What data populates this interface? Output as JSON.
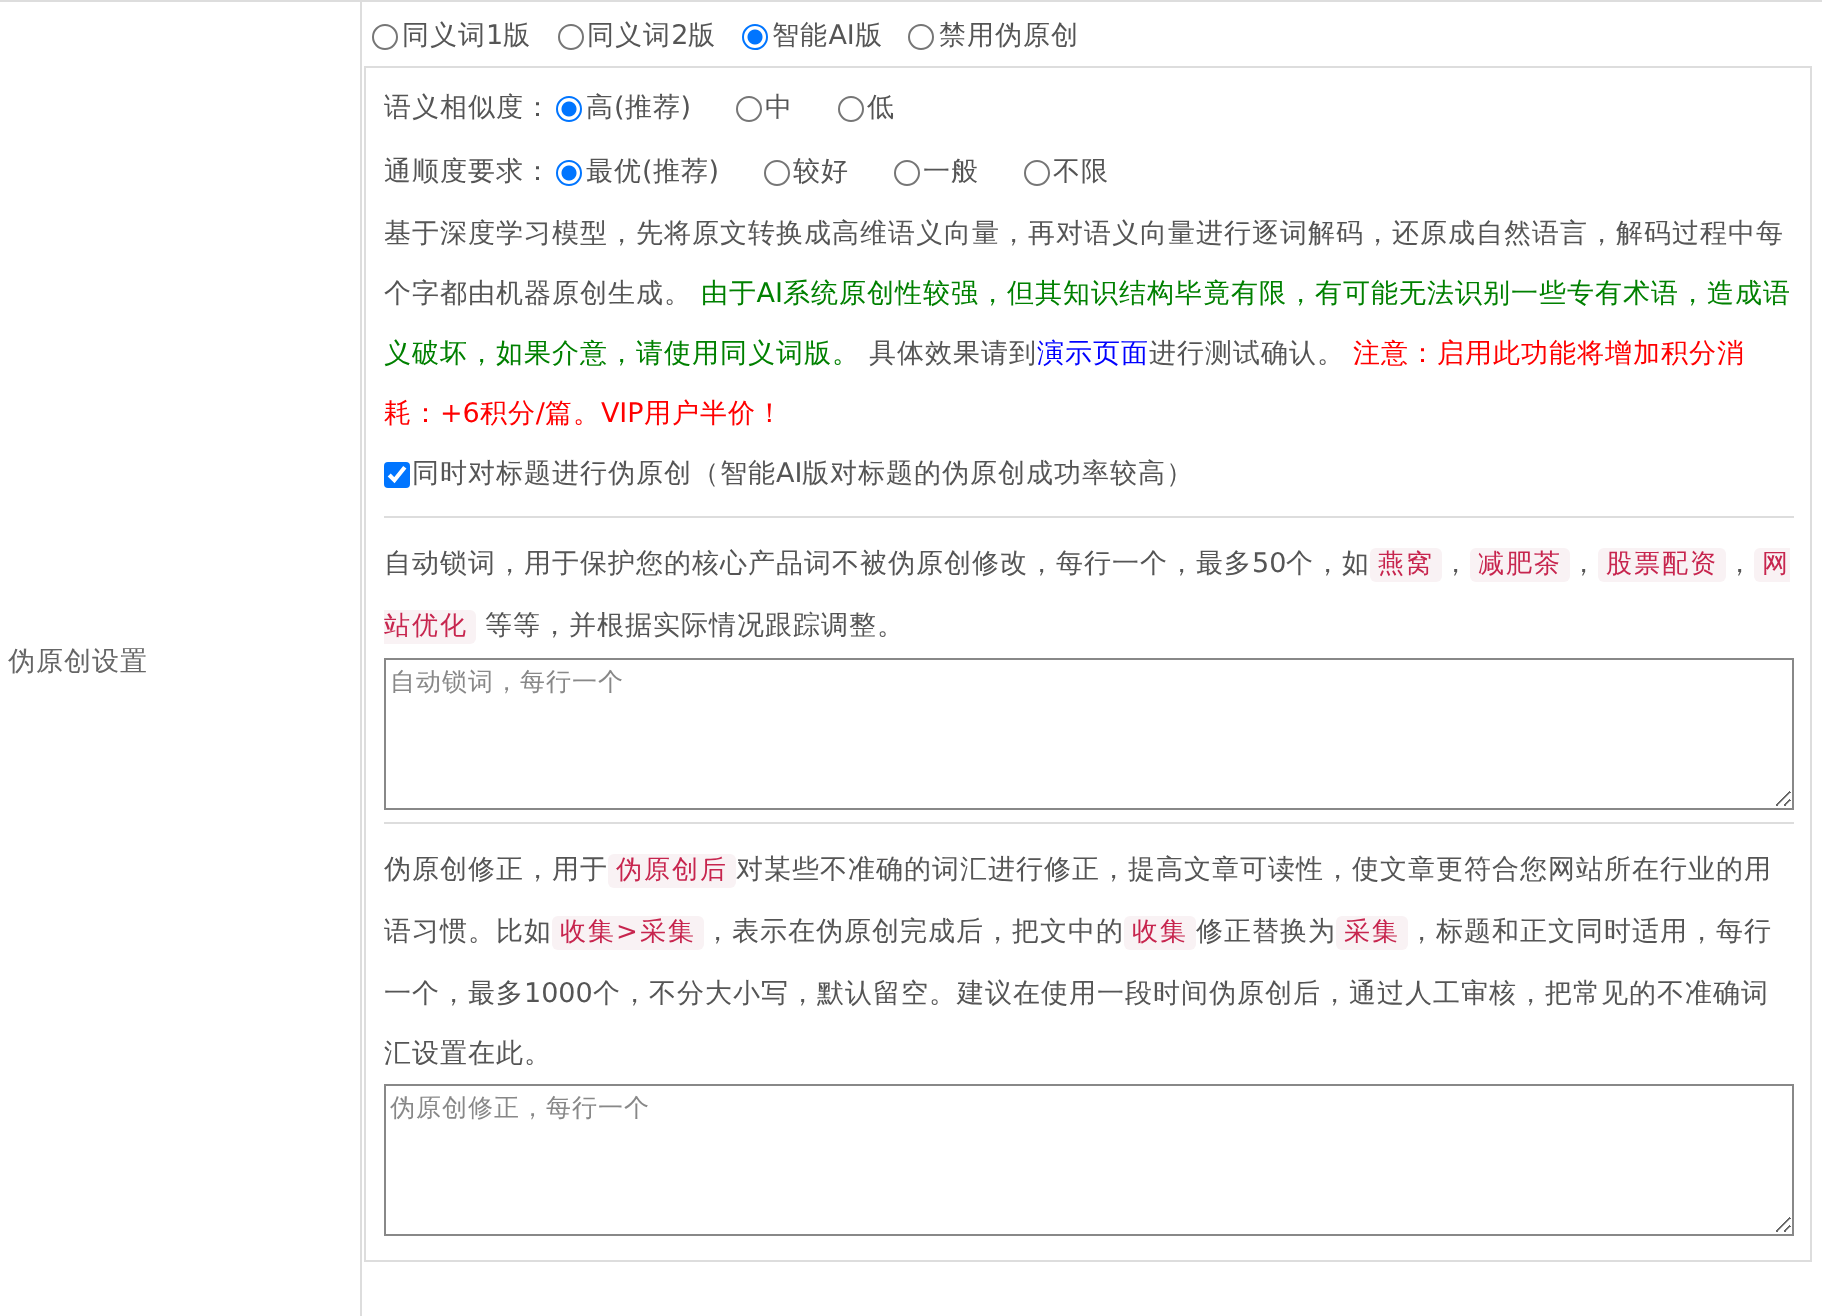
{
  "section_label": "伪原创设置",
  "mode_options": [
    {
      "label": "同义词1版",
      "selected": false
    },
    {
      "label": "同义词2版",
      "selected": false
    },
    {
      "label": "智能AI版",
      "selected": true
    },
    {
      "label": "禁用伪原创",
      "selected": false
    }
  ],
  "settings": [
    {
      "label": "语义相似度：",
      "options": [
        {
          "label": "高(推荐)",
          "selected": true
        },
        {
          "label": "中",
          "selected": false
        },
        {
          "label": "低",
          "selected": false
        }
      ]
    },
    {
      "label": "通顺度要求：",
      "options": [
        {
          "label": "最优(推荐)",
          "selected": true
        },
        {
          "label": "较好",
          "selected": false
        },
        {
          "label": "一般",
          "selected": false
        },
        {
          "label": "不限",
          "selected": false
        }
      ]
    }
  ],
  "ai_description": [
    {
      "kind": "text",
      "text": "基于深度学习模型，先将原文转换成高维语义向量，再对语义向量进行逐词解码，还原成自然语言，解码过程中每个字都由机器原创生成。 "
    },
    {
      "kind": "note",
      "text": "由于AI系统原创性较强，但其知识结构毕竟有限，有可能无法识别一些专有术语，造成语义破坏，如果介意，请使用同义词版。"
    },
    {
      "kind": "text",
      "text": " 具体效果请到"
    },
    {
      "kind": "link",
      "text": "演示页面"
    },
    {
      "kind": "text",
      "text": "进行测试确认。 "
    },
    {
      "kind": "warning",
      "text": "注意：启用此功能将增加积分消耗：+6积分/篇。VIP用户半价！"
    }
  ],
  "title_option": {
    "label": "同时对标题进行伪原创（智能AI版对标题的伪原创成功率较高）",
    "checked": true
  },
  "lock_words": {
    "description": [
      {
        "kind": "text",
        "text": "自动锁词，用于保护您的核心产品词不被伪原创修改，每行一个，最多50个，如"
      },
      {
        "kind": "code",
        "text": "燕窝"
      },
      {
        "kind": "text",
        "text": "，"
      },
      {
        "kind": "code",
        "text": "减肥茶"
      },
      {
        "kind": "text",
        "text": "，"
      },
      {
        "kind": "code",
        "text": "股票配资"
      },
      {
        "kind": "text",
        "text": "，"
      },
      {
        "kind": "code",
        "text": "网站优化"
      },
      {
        "kind": "text",
        "text": " 等等，并根据实际情况跟踪调整。"
      }
    ],
    "placeholder": "自动锁词，每行一个"
  },
  "correction": {
    "description": [
      {
        "kind": "text",
        "text": "伪原创修正，用于"
      },
      {
        "kind": "code",
        "text": "伪原创后"
      },
      {
        "kind": "text",
        "text": "对某些不准确的词汇进行修正，提高文章可读性，使文章更符合您网站所在行业的用语习惯。比如"
      },
      {
        "kind": "code",
        "text": "收集>采集"
      },
      {
        "kind": "text",
        "text": "，表示在伪原创完成后，把文中的"
      },
      {
        "kind": "code",
        "text": "收集"
      },
      {
        "kind": "text",
        "text": "修正替换为"
      },
      {
        "kind": "code",
        "text": "采集"
      },
      {
        "kind": "text",
        "text": "，标题和正文同时适用，每行一个，最多1000个，不分大小写，默认留空。建议在使用一段时间伪原创后，通过人工审核，把常见的不准确词汇设置在此。"
      }
    ],
    "placeholder": "伪原创修正，每行一个"
  }
}
